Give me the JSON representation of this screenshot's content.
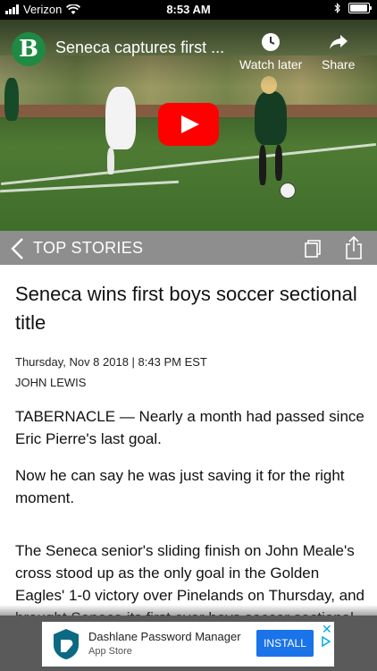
{
  "status_bar": {
    "carrier": "Verizon",
    "time": "8:53 AM"
  },
  "video": {
    "channel_logo_letter": "B",
    "title": "Seneca captures first ...",
    "watch_later_label": "Watch later",
    "share_label": "Share"
  },
  "section": {
    "title": "TOP STORIES"
  },
  "article": {
    "headline": "Seneca wins first boys soccer sectional title",
    "dateline": "Thursday, Nov 8 2018 | 8:43 PM EST",
    "author": "JOHN LEWIS",
    "paragraphs": [
      "TABERNACLE — Nearly a month had passed since Eric Pierre's last goal.",
      "Now he can say he was just saving it for the right moment.",
      "The Seneca senior's sliding finish on John Meale's cross stood up as the only goal in the Golden Eagles' 1-0 victory over Pinelands on Thursday, and brought Seneca its first ever boys soccer sectional championship."
    ]
  },
  "ad": {
    "app_name": "Dashlane Password Manager",
    "store": "App Store",
    "install_label": "INSTALL",
    "close_glyph": "✕"
  },
  "colors": {
    "section_header": "#8e8e8e",
    "brand_green": "#1f8a43",
    "install_blue": "#1a73e8",
    "play_red": "#ff0000"
  }
}
